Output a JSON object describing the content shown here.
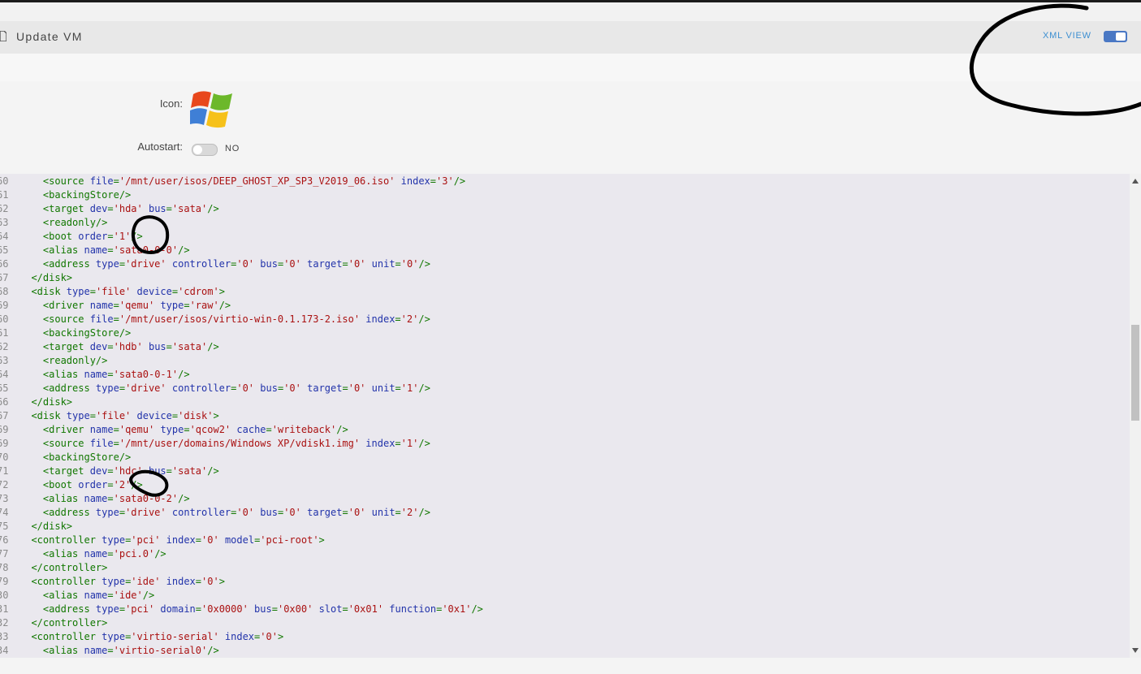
{
  "header": {
    "title": "Update VM",
    "xml_view_label": "XML VIEW",
    "xml_view_state": "on"
  },
  "settings": {
    "icon_label": "Icon:",
    "icon_name": "windows-xp-logo-icon",
    "autostart_label": "Autostart:",
    "autostart_value": "NO"
  },
  "code": {
    "lines": [
      {
        "n": "60",
        "t": "    <source file='/mnt/user/isos/DEEP_GHOST_XP_SP3_V2019_06.iso' index='3'/>"
      },
      {
        "n": "61",
        "t": "    <backingStore/>"
      },
      {
        "n": "62",
        "t": "    <target dev='hda' bus='sata'/>"
      },
      {
        "n": "63",
        "t": "    <readonly/>"
      },
      {
        "n": "64",
        "t": "    <boot order='1'/>"
      },
      {
        "n": "65",
        "t": "    <alias name='sata0-0-0'/>"
      },
      {
        "n": "66",
        "t": "    <address type='drive' controller='0' bus='0' target='0' unit='0'/>"
      },
      {
        "n": "67",
        "t": "  </disk>"
      },
      {
        "n": "68",
        "t": "  <disk type='file' device='cdrom'>"
      },
      {
        "n": "69",
        "t": "    <driver name='qemu' type='raw'/>"
      },
      {
        "n": "60",
        "t": "    <source file='/mnt/user/isos/virtio-win-0.1.173-2.iso' index='2'/>"
      },
      {
        "n": "61",
        "t": "    <backingStore/>"
      },
      {
        "n": "62",
        "t": "    <target dev='hdb' bus='sata'/>"
      },
      {
        "n": "63",
        "t": "    <readonly/>"
      },
      {
        "n": "64",
        "t": "    <alias name='sata0-0-1'/>"
      },
      {
        "n": "65",
        "t": "    <address type='drive' controller='0' bus='0' target='0' unit='1'/>"
      },
      {
        "n": "66",
        "t": "  </disk>"
      },
      {
        "n": "67",
        "t": "  <disk type='file' device='disk'>"
      },
      {
        "n": "69",
        "t": "    <driver name='qemu' type='qcow2' cache='writeback'/>"
      },
      {
        "n": "69",
        "t": "    <source file='/mnt/user/domains/Windows XP/vdisk1.img' index='1'/>"
      },
      {
        "n": "70",
        "t": "    <backingStore/>"
      },
      {
        "n": "71",
        "t": "    <target dev='hdc' bus='sata'/>"
      },
      {
        "n": "72",
        "t": "    <boot order='2'/>"
      },
      {
        "n": "73",
        "t": "    <alias name='sata0-0-2'/>"
      },
      {
        "n": "74",
        "t": "    <address type='drive' controller='0' bus='0' target='0' unit='2'/>"
      },
      {
        "n": "75",
        "t": "  </disk>"
      },
      {
        "n": "76",
        "t": "  <controller type='pci' index='0' model='pci-root'>"
      },
      {
        "n": "77",
        "t": "    <alias name='pci.0'/>"
      },
      {
        "n": "78",
        "t": "  </controller>"
      },
      {
        "n": "79",
        "t": "  <controller type='ide' index='0'>"
      },
      {
        "n": "30",
        "t": "    <alias name='ide'/>"
      },
      {
        "n": "31",
        "t": "    <address type='pci' domain='0x0000' bus='0x00' slot='0x01' function='0x1'/>"
      },
      {
        "n": "32",
        "t": "  </controller>"
      },
      {
        "n": "33",
        "t": "  <controller type='virtio-serial' index='0'>"
      },
      {
        "n": "34",
        "t": "    <alias name='virtio-serial0'/>"
      }
    ],
    "highlights": [
      {
        "line": 4,
        "text": "boot order",
        "color": "orange"
      },
      {
        "line": 22,
        "text": "boot order",
        "color": "yellow"
      }
    ]
  },
  "colors": {
    "tag": "#117700",
    "attribute": "#2233aa",
    "value": "#aa1111",
    "highlight_orange": "#f2a05a",
    "highlight_yellow": "#f0f03c",
    "toggle_on": "#4a78c4",
    "xml_label": "#3d8fd1"
  }
}
